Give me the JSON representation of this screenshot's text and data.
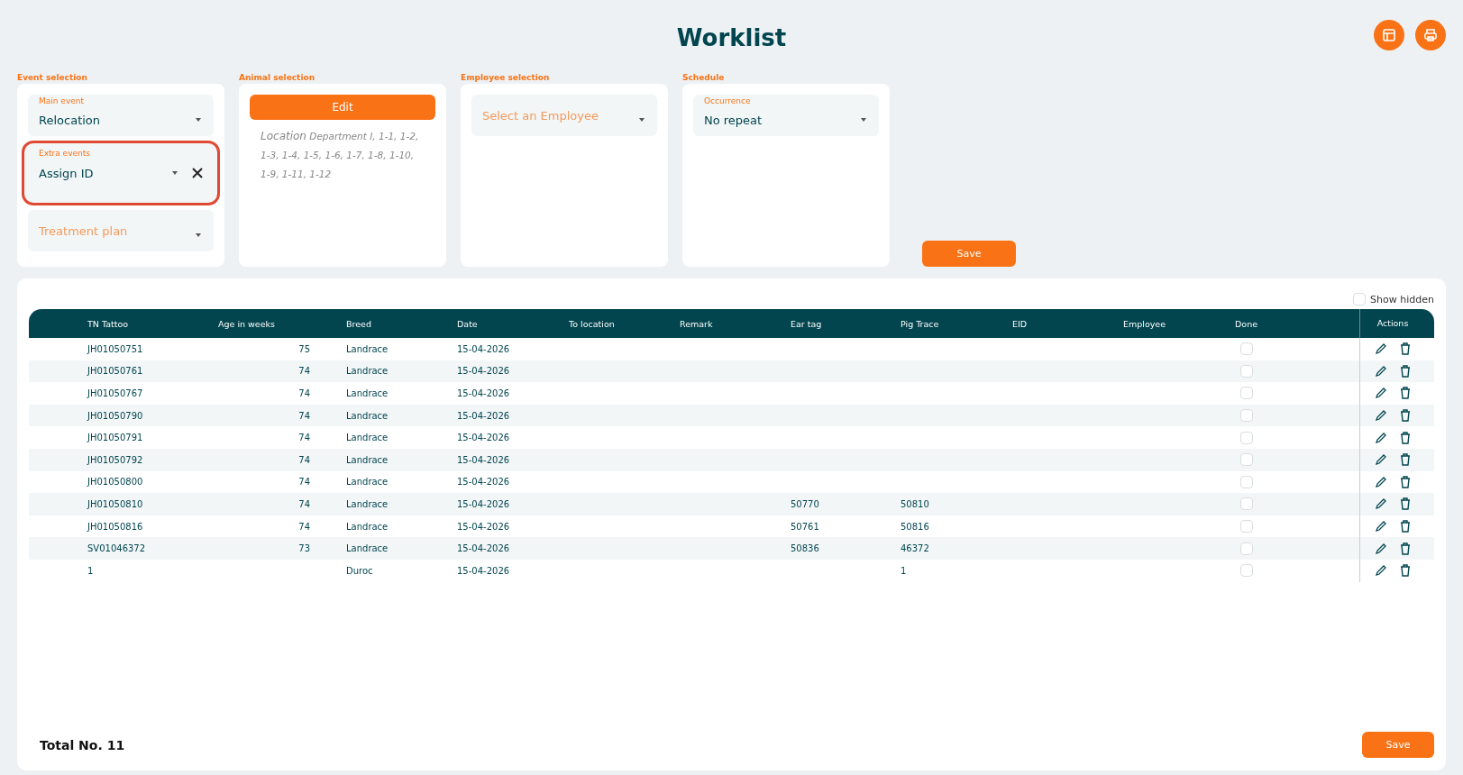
{
  "title": "Worklist",
  "header_actions": [
    {
      "kind": "layout"
    },
    {
      "kind": "print"
    }
  ],
  "panels": [
    {
      "label": "Event selection",
      "fields": [
        {
          "kind": "select",
          "label": "Main event",
          "value": "Relocation"
        },
        {
          "kind": "select",
          "label": "Extra events",
          "value": "Assign ID",
          "clearable": true,
          "highlighted": true
        },
        {
          "kind": "select",
          "placeholder": "Treatment plan"
        }
      ]
    },
    {
      "label": "Animal selection",
      "button": "Edit",
      "location_label": "Location",
      "location_text": "Department I, 1-1, 1-2, 1-3, 1-4, 1-5, 1-6, 1-7, 1-8, 1-10, 1-9, 1-11, 1-12"
    },
    {
      "label": "Employee selection",
      "fields": [
        {
          "kind": "select",
          "placeholder": "Select an Employee"
        }
      ]
    },
    {
      "label": "Schedule",
      "fields": [
        {
          "kind": "select",
          "label": "Occurrence",
          "value": "No repeat"
        }
      ]
    }
  ],
  "save_button": "Save",
  "show_hidden": {
    "label": "Show hidden",
    "checked": false
  },
  "table": {
    "columns": [
      "TN Tattoo",
      "Age in weeks",
      "Breed",
      "Date",
      "To location",
      "Remark",
      "Ear tag",
      "Pig Trace",
      "EID",
      "Employee",
      "Done",
      "Actions"
    ],
    "rows": [
      {
        "tattoo": "JH01050751",
        "age": "75",
        "breed": "Landrace",
        "date": "15-04-2026",
        "ear_tag": "",
        "pig_trace": "",
        "done": false
      },
      {
        "tattoo": "JH01050761",
        "age": "74",
        "breed": "Landrace",
        "date": "15-04-2026",
        "ear_tag": "",
        "pig_trace": "",
        "done": false
      },
      {
        "tattoo": "JH01050767",
        "age": "74",
        "breed": "Landrace",
        "date": "15-04-2026",
        "ear_tag": "",
        "pig_trace": "",
        "done": false
      },
      {
        "tattoo": "JH01050790",
        "age": "74",
        "breed": "Landrace",
        "date": "15-04-2026",
        "ear_tag": "",
        "pig_trace": "",
        "done": false
      },
      {
        "tattoo": "JH01050791",
        "age": "74",
        "breed": "Landrace",
        "date": "15-04-2026",
        "ear_tag": "",
        "pig_trace": "",
        "done": false
      },
      {
        "tattoo": "JH01050792",
        "age": "74",
        "breed": "Landrace",
        "date": "15-04-2026",
        "ear_tag": "",
        "pig_trace": "",
        "done": false
      },
      {
        "tattoo": "JH01050800",
        "age": "74",
        "breed": "Landrace",
        "date": "15-04-2026",
        "ear_tag": "",
        "pig_trace": "",
        "done": false
      },
      {
        "tattoo": "JH01050810",
        "age": "74",
        "breed": "Landrace",
        "date": "15-04-2026",
        "ear_tag": "50770",
        "pig_trace": "50810",
        "done": false
      },
      {
        "tattoo": "JH01050816",
        "age": "74",
        "breed": "Landrace",
        "date": "15-04-2026",
        "ear_tag": "50761",
        "pig_trace": "50816",
        "done": false
      },
      {
        "tattoo": "SV01046372",
        "age": "73",
        "breed": "Landrace",
        "date": "15-04-2026",
        "ear_tag": "50836",
        "pig_trace": "46372",
        "done": false
      },
      {
        "tattoo": "1",
        "age": "",
        "breed": "Duroc",
        "date": "15-04-2026",
        "ear_tag": "",
        "pig_trace": "1",
        "done": false
      }
    ]
  },
  "total": "Total No. 11",
  "footer_save": "Save"
}
